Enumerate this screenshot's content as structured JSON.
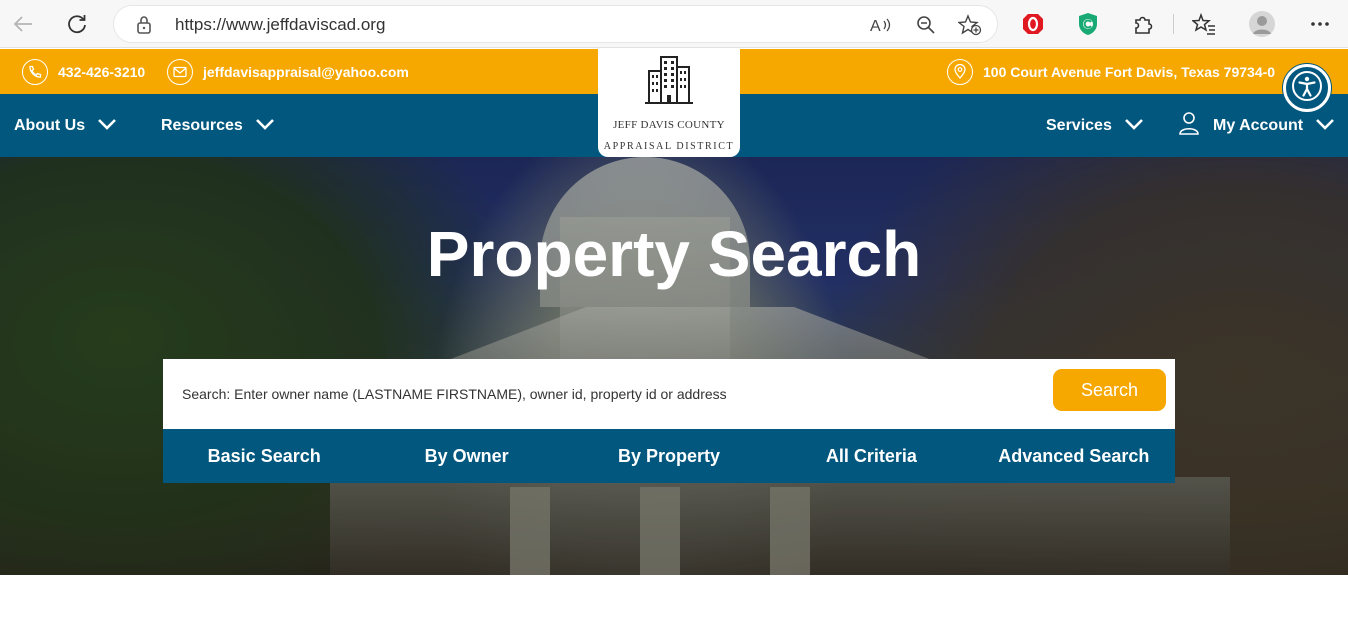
{
  "browser": {
    "url": "https://www.jeffdaviscad.org",
    "icons": [
      "back-icon",
      "reload-icon",
      "lock-icon",
      "read-aloud-icon",
      "zoom-out-icon",
      "add-favorite-icon",
      "opera-adblock-icon",
      "shield-extension-icon",
      "extensions-icon",
      "favorites-icon",
      "profile-avatar",
      "more-icon"
    ]
  },
  "topbar": {
    "phone": "432-426-3210",
    "email": "jeffdavisappraisal@yahoo.com",
    "address": "100 Court Avenue Fort Davis, Texas 79734-0"
  },
  "logo": {
    "line1": "JEFF DAVIS COUNTY",
    "line2": "APPRAISAL DISTRICT"
  },
  "nav": {
    "about": "About Us",
    "resources": "Resources",
    "services": "Services",
    "account": "My Account"
  },
  "hero": {
    "title": "Property Search",
    "search_placeholder": "Search: Enter owner name (LASTNAME FIRSTNAME), owner id, property id or address",
    "search_button": "Search",
    "tabs": [
      "Basic Search",
      "By Owner",
      "By Property",
      "All Criteria",
      "Advanced Search"
    ]
  },
  "colors": {
    "orange": "#f6a800",
    "blue": "#01577e"
  }
}
